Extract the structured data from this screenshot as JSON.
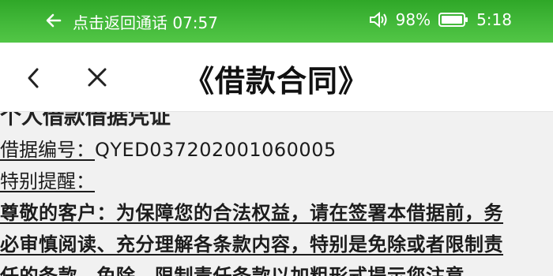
{
  "status_bar": {
    "call_text": "点击返回通话 07:57",
    "battery": "98%",
    "time": "5:18",
    "icons": [
      "back-arrow-icon",
      "speaker-icon",
      "battery-icon"
    ]
  },
  "nav": {
    "title": "《借款合同》",
    "back_icon": "chevron-left-icon",
    "close_icon": "close-icon"
  },
  "document": {
    "heading": "个人借款借据凭证",
    "ref_label": "借据编号：",
    "ref_number": "QYED037202001060005",
    "notice_label": "特别提醒：",
    "body_lines": [
      "尊敬的客户：为保障您的合法权益，请在签署本借据前，务",
      "必审慎阅读、充分理解各条款内容，特别是免除或者限制责",
      "任的条款，免除、限制责任条款以加粗形式提示您注意。"
    ]
  },
  "colors": {
    "status_bar_green": "#43b93a",
    "nav_background": "#ffffff",
    "content_background": "#f1f1f1"
  }
}
